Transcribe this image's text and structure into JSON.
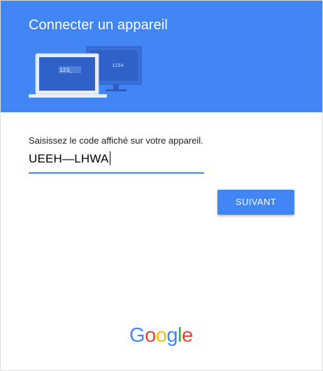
{
  "header": {
    "title": "Connecter un appareil",
    "background_color": "#4285f4",
    "illustration": {
      "laptop_screen_text": "123_",
      "monitor_screen_text": "1234"
    }
  },
  "form": {
    "code_label": "Saisissez le code affiché sur votre appareil.",
    "code_value": "UEEH—LHWA",
    "next_button_label": "SUIVANT",
    "accent_color": "#4285f4"
  },
  "footer": {
    "logo_letters": [
      "G",
      "o",
      "o",
      "g",
      "l",
      "e"
    ],
    "logo_colors": [
      "#4285f4",
      "#ea4335",
      "#fbbc05",
      "#4285f4",
      "#34a853",
      "#ea4335"
    ]
  }
}
